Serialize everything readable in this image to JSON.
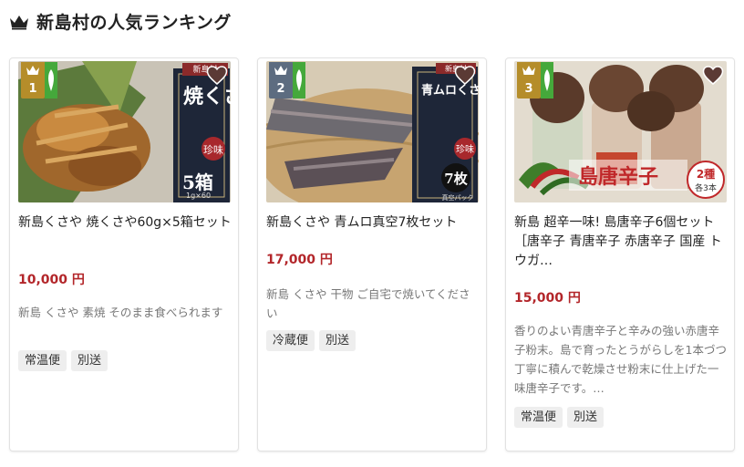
{
  "header": {
    "title": "新島村の人気ランキング",
    "icon": "crown-icon"
  },
  "colors": {
    "gold": "#b58d2a",
    "blue": "#5d6c80",
    "green": "#45a83b",
    "price": "#b3262a"
  },
  "products": [
    {
      "rank": "1",
      "name": "新島くさや 焼くさや60g×5箱セット",
      "price": "10,000 円",
      "desc": "新島 くさや 素焼 そのまま食べられます",
      "tags": [
        "常温便",
        "別送"
      ],
      "image": {
        "title": "焼くさや",
        "mark": "珍味",
        "count": "5箱",
        "brand": "新島村",
        "sub": "1g×60"
      }
    },
    {
      "rank": "2",
      "name": "新島くさや 青ムロ真空7枚セット",
      "price": "17,000 円",
      "desc": "新島 くさや 干物 ご自宅で焼いてください",
      "tags": [
        "冷蔵便",
        "別送"
      ],
      "image": {
        "title": "青ムロくさや",
        "mark": "珍味",
        "count": "7枚",
        "brand": "新島村",
        "sub": "真空パック"
      }
    },
    {
      "rank": "3",
      "name": "新島 超辛一味! 島唐辛子6個セット　［唐辛子 青唐辛子 赤唐辛子 国産 トウガ…",
      "price": "15,000 円",
      "desc": "香りのよい青唐辛子と辛みの強い赤唐辛子粉末。島で育ったとうがらしを1本づつ丁寧に積んで乾燥させ粉末に仕上げた一味唐辛子です。…",
      "tags": [
        "常温便",
        "別送"
      ],
      "image": {
        "title": "島唐辛子",
        "count": "2種",
        "sub": "各3本"
      }
    }
  ]
}
